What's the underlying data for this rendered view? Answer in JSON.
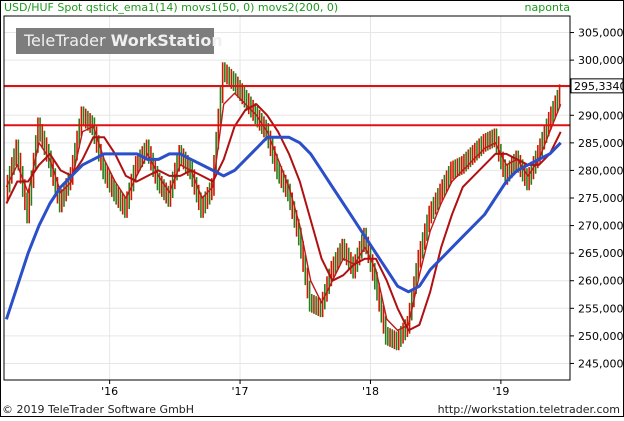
{
  "header": {
    "instrument_label": "USD/HUF Spot qstick_ema1(14) movs1(50, 0) movs2(200, 0)",
    "right_label": "naponta"
  },
  "watermark": {
    "brand_plain": "TeleTrader ",
    "brand_bold": "WorkStation"
  },
  "footer": {
    "copyright": "© 2019 TeleTrader Software GmbH",
    "url": "http://workstation.teletrader.com"
  },
  "colors": {
    "price_up": "#cc1a00",
    "price_down": "#2a7d1a",
    "ema": "#c01818",
    "sma50": "#b01010",
    "sma200": "#2a4fc8",
    "hline": "#e01010",
    "header_text": "#1c9a1c"
  },
  "chart_data": {
    "type": "line",
    "title": "USD/HUF Spot",
    "xlabel": "",
    "ylabel": "",
    "x_tick_labels": [
      "'16",
      "'17",
      "'18",
      "'19"
    ],
    "y_ticks": [
      "245,0000",
      "250,0000",
      "255,0000",
      "260,0000",
      "265,0000",
      "270,0000",
      "275,0000",
      "280,0000",
      "285,0000",
      "290,0000",
      "295,0000",
      "300,0000",
      "305,0000"
    ],
    "ylim": [
      242,
      308
    ],
    "last_value_label": "295,3340",
    "last_value": 295.334,
    "horizontal_lines": [
      295.3,
      288.2
    ],
    "x": [
      "2015-03",
      "2015-04",
      "2015-05",
      "2015-06",
      "2015-07",
      "2015-08",
      "2015-09",
      "2015-10",
      "2015-11",
      "2015-12",
      "2016-01",
      "2016-02",
      "2016-03",
      "2016-04",
      "2016-05",
      "2016-06",
      "2016-07",
      "2016-08",
      "2016-09",
      "2016-10",
      "2016-11",
      "2016-12",
      "2017-01",
      "2017-02",
      "2017-03",
      "2017-04",
      "2017-05",
      "2017-06",
      "2017-07",
      "2017-08",
      "2017-09",
      "2017-10",
      "2017-11",
      "2017-12",
      "2018-01",
      "2018-02",
      "2018-03",
      "2018-04",
      "2018-05",
      "2018-06",
      "2018-07",
      "2018-08",
      "2018-09",
      "2018-10",
      "2018-11",
      "2018-12",
      "2019-01",
      "2019-02",
      "2019-03",
      "2019-04",
      "2019-05",
      "2019-06"
    ],
    "series": [
      {
        "name": "USD/HUF Spot",
        "style": "price",
        "values": [
          276,
          284,
          272,
          288,
          282,
          274,
          279,
          290,
          288,
          280,
          276,
          273,
          281,
          284,
          278,
          275,
          283,
          280,
          273,
          277,
          298,
          296,
          293,
          290,
          287,
          280,
          276,
          268,
          256,
          255,
          262,
          266,
          262,
          268,
          260,
          250,
          249,
          252,
          264,
          272,
          276,
          280,
          281,
          283,
          285,
          286,
          279,
          282,
          278,
          283,
          289,
          294
        ]
      },
      {
        "name": "qstick_ema1(14)",
        "values": [
          277,
          281,
          276,
          285,
          282,
          276,
          278,
          287,
          288,
          282,
          278,
          275,
          279,
          283,
          279,
          276,
          281,
          280,
          275,
          277,
          292,
          294,
          292,
          290,
          287,
          282,
          277,
          270,
          260,
          256,
          260,
          264,
          263,
          266,
          262,
          253,
          251,
          252,
          261,
          269,
          274,
          278,
          280,
          282,
          284,
          285,
          281,
          282,
          279,
          282,
          287,
          292
        ]
      },
      {
        "name": "movs1(50, 0)",
        "values": [
          274,
          278,
          278,
          281,
          283,
          280,
          279,
          282,
          286,
          286,
          283,
          279,
          278,
          279,
          280,
          279,
          279,
          280,
          279,
          278,
          282,
          288,
          291,
          292,
          290,
          287,
          283,
          278,
          271,
          264,
          260,
          261,
          263,
          264,
          264,
          260,
          255,
          251,
          252,
          258,
          266,
          272,
          277,
          279,
          281,
          283,
          283,
          282,
          281,
          281,
          283,
          287
        ]
      },
      {
        "name": "movs2(200, 0)",
        "values": [
          253,
          259,
          265,
          270,
          274,
          277,
          279,
          281,
          282,
          283,
          283,
          283,
          283,
          282,
          282,
          283,
          283,
          282,
          281,
          280,
          279,
          280,
          282,
          284,
          286,
          286,
          286,
          285,
          283,
          280,
          277,
          274,
          271,
          268,
          265,
          262,
          259,
          258,
          259,
          262,
          264,
          266,
          268,
          270,
          272,
          275,
          278,
          280,
          281,
          282,
          283,
          285
        ]
      }
    ]
  }
}
